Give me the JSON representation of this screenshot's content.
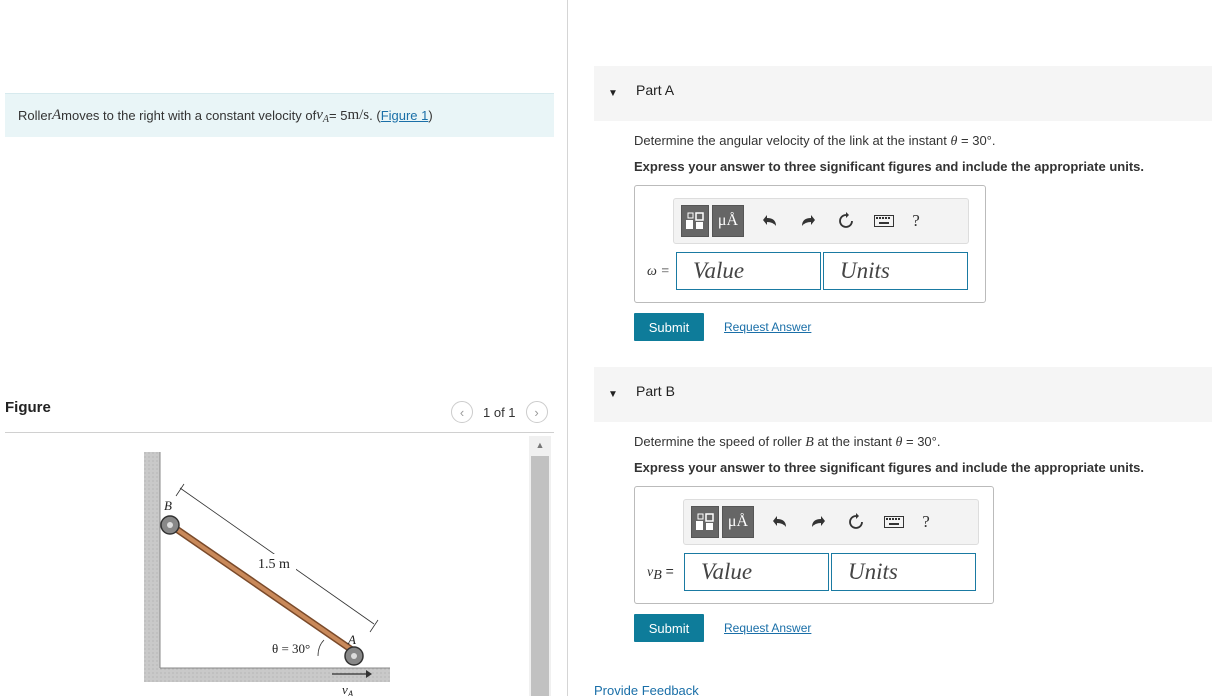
{
  "problem": {
    "text_before": "Roller ",
    "var_A": "A",
    "text_mid": " moves to the right with a constant velocity of ",
    "v": "v",
    "v_sub": "A",
    "equals": " = 5 ",
    "unit": "m/s",
    "text_after": ". (",
    "figure_link": "Figure 1",
    "close_paren": ")"
  },
  "figure": {
    "title": "Figure",
    "count": "1 of 1",
    "labels": {
      "B": "B",
      "A": "A",
      "length": "1.5 m",
      "theta": "θ = 30°",
      "vA": "v",
      "vA_sub": "A"
    }
  },
  "partA": {
    "title": "Part A",
    "question_pre": "Determine the angular velocity of the link at the instant ",
    "theta": "θ",
    "question_post": " = 30°.",
    "instruction": "Express your answer to three significant figures and include the appropriate units.",
    "label": "ω =",
    "value_placeholder": "Value",
    "units_placeholder": "Units",
    "submit": "Submit",
    "request": "Request Answer"
  },
  "partB": {
    "title": "Part B",
    "question_pre": "Determine the speed of roller ",
    "var_B": "B",
    "question_mid": " at the instant ",
    "theta": "θ",
    "question_post": " = 30°.",
    "instruction": "Express your answer to three significant figures and include the appropriate units.",
    "label_v": "v",
    "label_sub": "B",
    "label_eq": " =",
    "value_placeholder": "Value",
    "units_placeholder": "Units",
    "submit": "Submit",
    "request": "Request Answer"
  },
  "toolbar": {
    "mu_text": "μÅ",
    "help": "?"
  },
  "feedback": "Provide Feedback",
  "colors": {
    "accent": "#0e7c9a",
    "link": "#1a6fa8",
    "problem_bg": "#e9f5f7"
  }
}
